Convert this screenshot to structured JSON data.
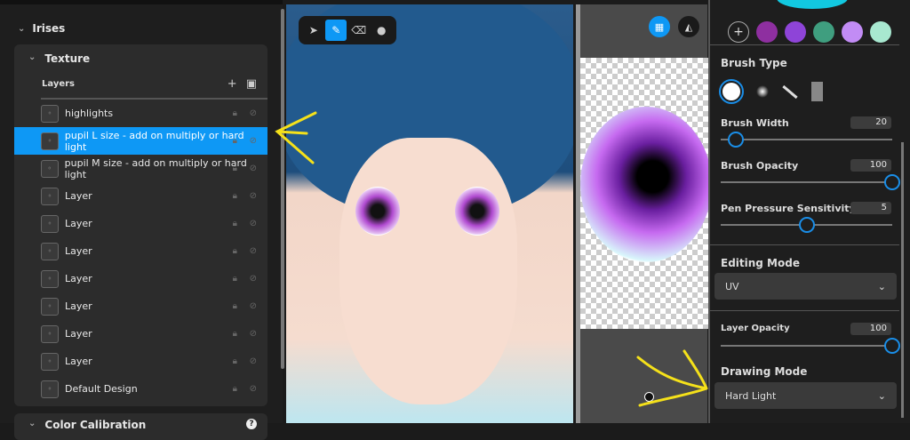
{
  "left_panel": {
    "section": "Irises",
    "texture": "Texture",
    "layers_label": "Layers",
    "layers": [
      {
        "name": "highlights",
        "selected": false
      },
      {
        "name": "pupil L size - add on multiply or hard light",
        "selected": true
      },
      {
        "name": "pupil M size - add on multiply or hard light",
        "selected": false
      },
      {
        "name": "Layer",
        "selected": false
      },
      {
        "name": "Layer",
        "selected": false
      },
      {
        "name": "Layer",
        "selected": false
      },
      {
        "name": "Layer",
        "selected": false
      },
      {
        "name": "Layer",
        "selected": false
      },
      {
        "name": "Layer",
        "selected": false
      },
      {
        "name": "Layer",
        "selected": false
      },
      {
        "name": "Default Design",
        "selected": false
      }
    ],
    "color_calibration": "Color Calibration"
  },
  "toolbar": {
    "tools": [
      "select-tool",
      "brush-tool",
      "eraser-tool",
      "fill-tool"
    ],
    "active": "brush-tool"
  },
  "right_panel": {
    "swatches": [
      "#8e2fa0",
      "#8e44d8",
      "#3f9e7f",
      "#c28cf5",
      "#a8e8d0"
    ],
    "brush_type_label": "Brush Type",
    "brush_width_label": "Brush Width",
    "brush_width": "20",
    "brush_width_frac": 0.09,
    "brush_opacity_label": "Brush Opacity",
    "brush_opacity": "100",
    "brush_opacity_frac": 1,
    "pen_pressure_label": "Pen Pressure Sensitivity",
    "pen_pressure": "5",
    "pen_pressure_frac": 0.5,
    "editing_mode_label": "Editing Mode",
    "editing_mode": "UV",
    "layer_opacity_label": "Layer Opacity",
    "layer_opacity": "100",
    "layer_opacity_frac": 1,
    "drawing_mode_label": "Drawing Mode",
    "drawing_mode": "Hard Light"
  },
  "colors": {
    "accent": "#0e98f5",
    "annotation": "#f5e11a"
  }
}
